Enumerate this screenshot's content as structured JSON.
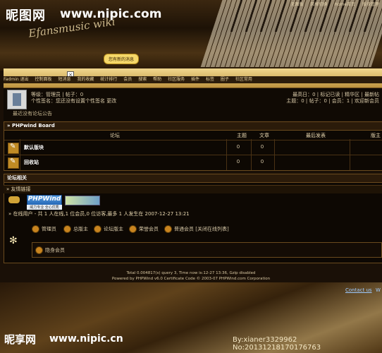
{
  "watermark": {
    "top_logo": "昵图网",
    "top_url": "www.nipic.com",
    "bottom_logo": "昵享网",
    "bottom_url": "www.nipic.cn",
    "bottom_id": "By:xianer3329962 No:20131218170176763"
  },
  "header": {
    "logo_script": "Efansmusic wiki",
    "top_links": [
      "无图版",
      "风格切换",
      "Home首页",
      "版块管理"
    ],
    "message_bubble": "您有新的消息"
  },
  "nav": {
    "items": [
      "Fadmin 退出",
      "控制面板",
      "短消息",
      "我的收藏",
      "统计排行",
      "会员",
      "搜索",
      "帮助",
      "社区服务",
      "插件",
      "标签",
      "圈子",
      "社区常用"
    ]
  },
  "user_panel": {
    "level_line": "等级：管理员 | 帖子：0",
    "signature_line": "个性签名：您还没有设置个性签名 更改",
    "today_line": "最高日：0 | 标记已读 | 精华区 | 最新帖",
    "stats_line": "主题：0 | 帖子：0 | 会员：1 | 欢迎新会员",
    "notice": "最近没有论坛公告"
  },
  "board": {
    "section_title": "» PHPwind Board",
    "columns": [
      "论坛",
      "主题",
      "文章",
      "最后发表",
      "版主"
    ],
    "rows": [
      {
        "name": "默认版块",
        "topics": "0",
        "posts": "0"
      },
      {
        "name": "回收站",
        "topics": "0",
        "posts": "0"
      }
    ]
  },
  "forum_related": {
    "title": "论坛相关",
    "friend_links": "» 友情链接",
    "phpwind_logo": "PHPWind",
    "phpwind_sub": "威力专业 全心优秀",
    "online_line": "» 在线用户 - 共 1 人在线,1 位会员,0 位访客,最多 1 人发生在 2007-12-27 13:21",
    "groups": [
      "管理员",
      "总版主",
      "论坛版主",
      "荣誉会员",
      "普通会员 [关闭在线列表]"
    ],
    "hidden_member": "隐身会员"
  },
  "footer": {
    "line1": "Total 0.004817(s) query 3, Time now is:12-27 13:36, Gzip disabled",
    "line2": "Powered by PHPWind v6.0 Certificate Code © 2003-07 PHPWind.com Corporation",
    "contact": "Contact us",
    "wap": "W"
  }
}
